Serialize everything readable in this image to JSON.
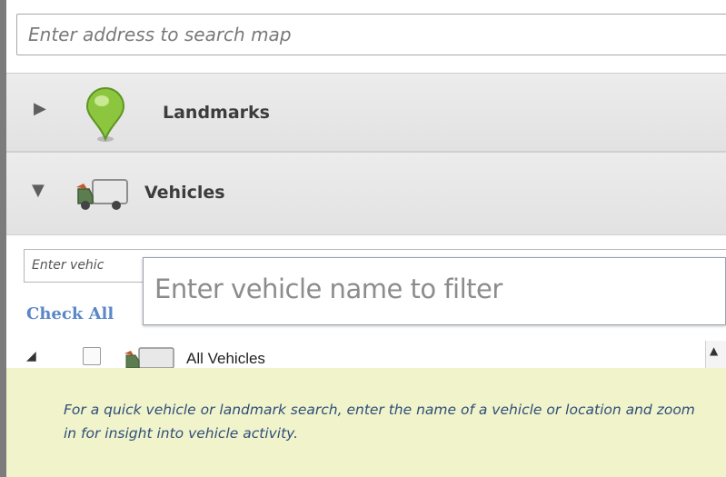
{
  "search": {
    "placeholder": "Enter address to search map"
  },
  "sections": {
    "landmarks": {
      "label": "Landmarks",
      "expanded": false,
      "icon": "map-pin-icon"
    },
    "vehicles": {
      "label": "Vehicles",
      "expanded": true,
      "icon": "truck-icon",
      "filter_placeholder": "Enter vehic",
      "check_all_label": "Check All",
      "tree": [
        {
          "label": "All Vehicles",
          "expanded": true,
          "checked": false,
          "icon": "truck-icon"
        }
      ]
    }
  },
  "callout": {
    "text": "Enter vehicle name to filter"
  },
  "caption": {
    "text": "For a quick vehicle or landmark search, enter the name of a vehicle or location and zoom in for insight into vehicle activity."
  },
  "colors": {
    "accent_link": "#5a87c8",
    "caption_bg": "#f1f3cb",
    "caption_text": "#2f4f7a",
    "pin_green": "#8cc63f"
  }
}
